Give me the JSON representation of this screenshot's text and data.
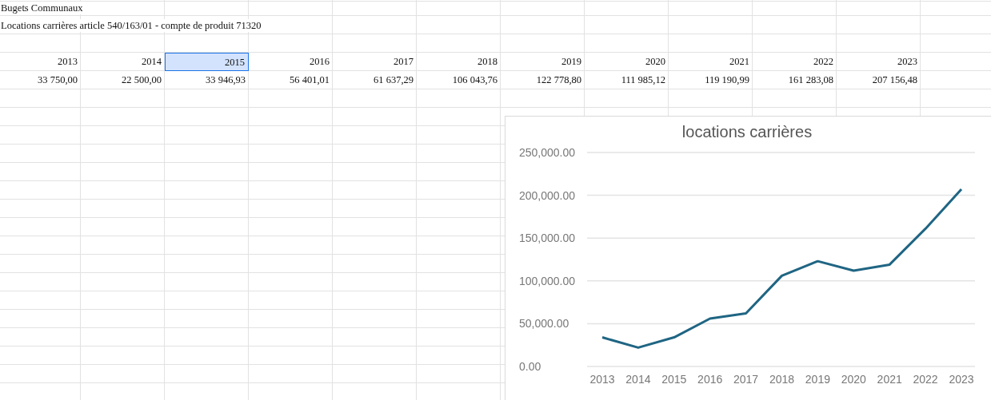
{
  "sheet": {
    "title": "Bugets Communaux",
    "subtitle": "Locations carrières article 540/163/01 - compte de produit 71320",
    "years": [
      {
        "label": "2013",
        "selected": false
      },
      {
        "label": "2014",
        "selected": false
      },
      {
        "label": "2015",
        "selected": true
      },
      {
        "label": "2016",
        "selected": false
      },
      {
        "label": "2017",
        "selected": false
      },
      {
        "label": "2018",
        "selected": false
      },
      {
        "label": "2019",
        "selected": false
      },
      {
        "label": "2020",
        "selected": false
      },
      {
        "label": "2021",
        "selected": false
      },
      {
        "label": "2022",
        "selected": false
      },
      {
        "label": "2023",
        "selected": false
      }
    ],
    "values": [
      "33 750,00",
      "22 500,00",
      "33 946,93",
      "56 401,01",
      "61 637,29",
      "106 043,76",
      "122 778,80",
      "111 985,12",
      "119 190,99",
      "161 283,08",
      "207 156,48"
    ]
  },
  "chart": {
    "chart_data": {
      "type": "line",
      "title": "locations carrières",
      "categories": [
        "2013",
        "2014",
        "2015",
        "2016",
        "2017",
        "2018",
        "2019",
        "2020",
        "2021",
        "2022",
        "2023"
      ],
      "series": [
        {
          "color": "#1f6583",
          "values": [
            34000,
            22000,
            34000,
            56000,
            62000,
            106000,
            123000,
            112000,
            119000,
            161000,
            207000
          ]
        }
      ],
      "grid": true,
      "ylim": [
        0,
        250000
      ],
      "yticks": [
        {
          "value": 0,
          "label": "0.00"
        },
        {
          "value": 50000,
          "label": "50,000.00"
        },
        {
          "value": 100000,
          "label": "100,000.00"
        },
        {
          "value": 150000,
          "label": "150,000.00"
        },
        {
          "value": 200000,
          "label": "200,000.00"
        },
        {
          "value": 250000,
          "label": "250,000.00"
        }
      ]
    }
  }
}
